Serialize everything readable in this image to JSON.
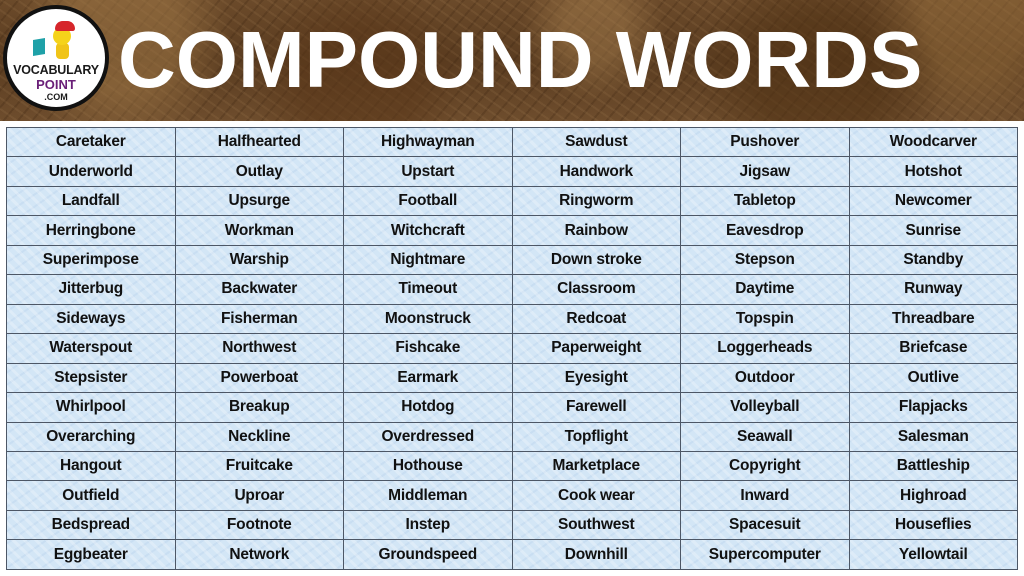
{
  "header": {
    "title": "COMPOUND WORDS",
    "logo": {
      "line1": "VOCABULARY",
      "line2": "POINT",
      "line3": ".COM"
    }
  },
  "colors": {
    "banner": "#5e3f22",
    "title_text": "#ffffff",
    "table_bg": "#d3e6f6",
    "grid_line": "#4d5766",
    "logo_point": "#6a1f78"
  },
  "table": {
    "rows": [
      [
        "Caretaker",
        "Halfhearted",
        "Highwayman",
        "Sawdust",
        "Pushover",
        "Woodcarver"
      ],
      [
        "Underworld",
        "Outlay",
        "Upstart",
        "Handwork",
        "Jigsaw",
        "Hotshot"
      ],
      [
        "Landfall",
        "Upsurge",
        "Football",
        "Ringworm",
        "Tabletop",
        "Newcomer"
      ],
      [
        "Herringbone",
        "Workman",
        "Witchcraft",
        "Rainbow",
        "Eavesdrop",
        "Sunrise"
      ],
      [
        "Superimpose",
        "Warship",
        "Nightmare",
        "Down stroke",
        "Stepson",
        "Standby"
      ],
      [
        "Jitterbug",
        "Backwater",
        "Timeout",
        "Classroom",
        "Daytime",
        "Runway"
      ],
      [
        "Sideways",
        "Fisherman",
        "Moonstruck",
        "Redcoat",
        "Topspin",
        "Threadbare"
      ],
      [
        "Waterspout",
        "Northwest",
        "Fishcake",
        "Paperweight",
        "Loggerheads",
        "Briefcase"
      ],
      [
        "Stepsister",
        "Powerboat",
        "Earmark",
        "Eyesight",
        "Outdoor",
        "Outlive"
      ],
      [
        "Whirlpool",
        "Breakup",
        "Hotdog",
        "Farewell",
        "Volleyball",
        "Flapjacks"
      ],
      [
        "Overarching",
        "Neckline",
        "Overdressed",
        "Topflight",
        "Seawall",
        "Salesman"
      ],
      [
        "Hangout",
        "Fruitcake",
        "Hothouse",
        "Marketplace",
        "Copyright",
        "Battleship"
      ],
      [
        "Outfield",
        "Uproar",
        "Middleman",
        "Cook wear",
        "Inward",
        "Highroad"
      ],
      [
        "Bedspread",
        "Footnote",
        "Instep",
        "Southwest",
        "Spacesuit",
        "Houseflies"
      ],
      [
        "Eggbeater",
        "Network",
        "Groundspeed",
        "Downhill",
        "Supercomputer",
        "Yellowtail"
      ]
    ]
  }
}
